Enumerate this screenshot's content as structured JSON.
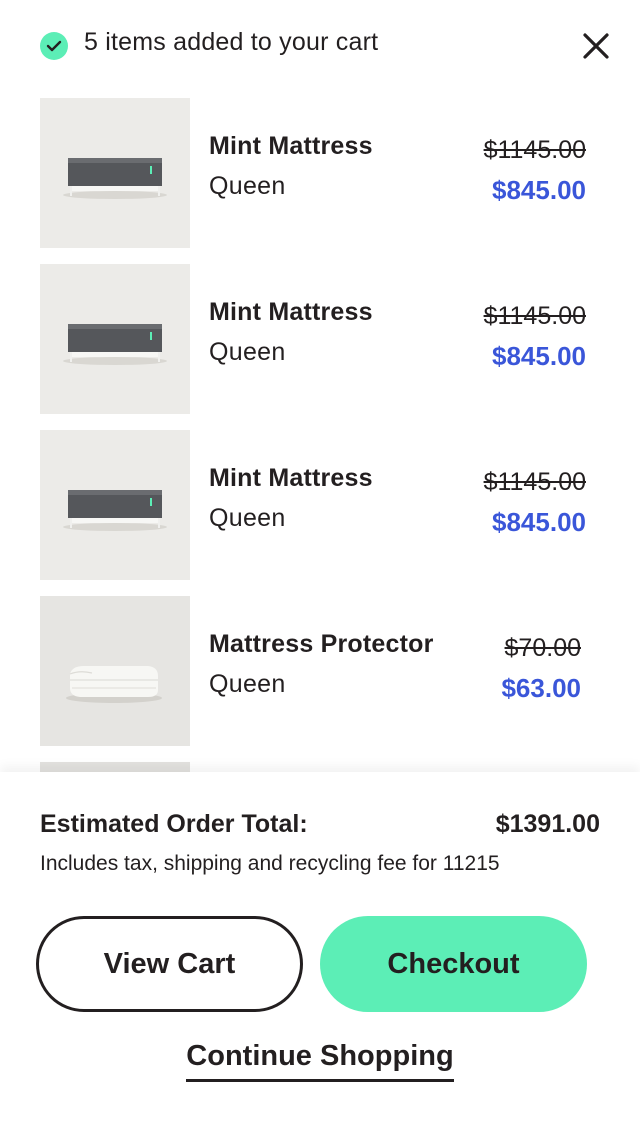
{
  "header": {
    "message": "5 items added to your cart",
    "check_icon": "check-circle-icon",
    "close_icon": "close-icon",
    "accent_color": "#5ceeb6"
  },
  "cart": {
    "items": [
      {
        "name": "Mint Mattress",
        "variant": "Queen",
        "original_price": "$1145.00",
        "sale_price": "$845.00",
        "image": "mattress"
      },
      {
        "name": "Mint Mattress",
        "variant": "Queen",
        "original_price": "$1145.00",
        "sale_price": "$845.00",
        "image": "mattress"
      },
      {
        "name": "Mint Mattress",
        "variant": "Queen",
        "original_price": "$1145.00",
        "sale_price": "$845.00",
        "image": "mattress"
      },
      {
        "name": "Mattress Protector",
        "variant": "Queen",
        "original_price": "$70.00",
        "sale_price": "$63.00",
        "image": "protector"
      }
    ],
    "sale_price_color": "#3a56d9"
  },
  "summary": {
    "total_label": "Estimated Order Total:",
    "total_value": "$1391.00",
    "note": "Includes tax, shipping and recycling fee for 11215",
    "view_cart_label": "View Cart",
    "checkout_label": "Checkout",
    "continue_label": "Continue Shopping"
  }
}
